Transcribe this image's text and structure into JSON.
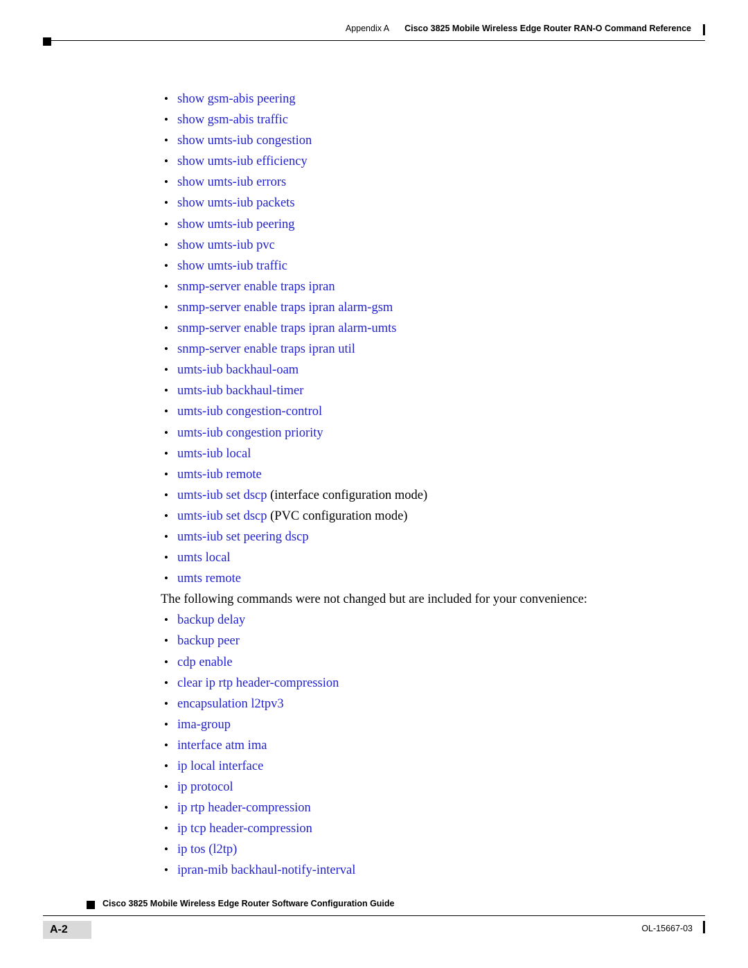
{
  "header": {
    "appendix": "Appendix A",
    "title": "Cisco 3825 Mobile Wireless Edge Router RAN-O Command Reference"
  },
  "main": {
    "list_one": [
      {
        "cmd": "show gsm-abis peering",
        "note": ""
      },
      {
        "cmd": "show gsm-abis traffic",
        "note": ""
      },
      {
        "cmd": "show umts-iub congestion",
        "note": ""
      },
      {
        "cmd": "show umts-iub efficiency",
        "note": ""
      },
      {
        "cmd": "show umts-iub errors",
        "note": ""
      },
      {
        "cmd": "show umts-iub packets",
        "note": ""
      },
      {
        "cmd": "show umts-iub peering",
        "note": ""
      },
      {
        "cmd": "show umts-iub pvc",
        "note": ""
      },
      {
        "cmd": "show umts-iub traffic",
        "note": ""
      },
      {
        "cmd": "snmp-server enable traps ipran",
        "note": ""
      },
      {
        "cmd": "snmp-server enable traps ipran alarm-gsm",
        "note": ""
      },
      {
        "cmd": "snmp-server enable traps ipran alarm-umts",
        "note": ""
      },
      {
        "cmd": "snmp-server enable traps ipran util",
        "note": ""
      },
      {
        "cmd": "umts-iub backhaul-oam",
        "note": ""
      },
      {
        "cmd": "umts-iub backhaul-timer",
        "note": ""
      },
      {
        "cmd": "umts-iub congestion-control",
        "note": ""
      },
      {
        "cmd": "umts-iub congestion priority",
        "note": ""
      },
      {
        "cmd": "umts-iub local",
        "note": ""
      },
      {
        "cmd": "umts-iub remote",
        "note": ""
      },
      {
        "cmd": "umts-iub set dscp",
        "note": " (interface configuration mode)"
      },
      {
        "cmd": "umts-iub set dscp",
        "note": " (PVC configuration mode)"
      },
      {
        "cmd": "umts-iub set peering dscp",
        "note": ""
      },
      {
        "cmd": "umts local",
        "note": ""
      },
      {
        "cmd": "umts remote",
        "note": ""
      }
    ],
    "paragraph": "The following commands were not changed but are included for your convenience:",
    "list_two": [
      {
        "cmd": "backup delay",
        "note": ""
      },
      {
        "cmd": "backup peer",
        "note": ""
      },
      {
        "cmd": "cdp enable",
        "note": ""
      },
      {
        "cmd": "clear ip rtp header-compression",
        "note": ""
      },
      {
        "cmd": "encapsulation l2tpv3",
        "note": ""
      },
      {
        "cmd": "ima-group",
        "note": ""
      },
      {
        "cmd": "interface atm ima",
        "note": ""
      },
      {
        "cmd": "ip local interface",
        "note": ""
      },
      {
        "cmd": "ip protocol",
        "note": ""
      },
      {
        "cmd": "ip rtp header-compression",
        "note": ""
      },
      {
        "cmd": "ip tcp header-compression",
        "note": ""
      },
      {
        "cmd": "ip tos (l2tp)",
        "note": ""
      },
      {
        "cmd": "ipran-mib backhaul-notify-interval",
        "note": ""
      }
    ]
  },
  "footer": {
    "guide_title": "Cisco 3825 Mobile Wireless Edge Router Software Configuration Guide",
    "page_number": "A-2",
    "doc_id": "OL-15667-03"
  },
  "colors": {
    "link_blue": "#2222cc",
    "text_black": "#000000",
    "page_box_gray": "#d9d9d9"
  }
}
